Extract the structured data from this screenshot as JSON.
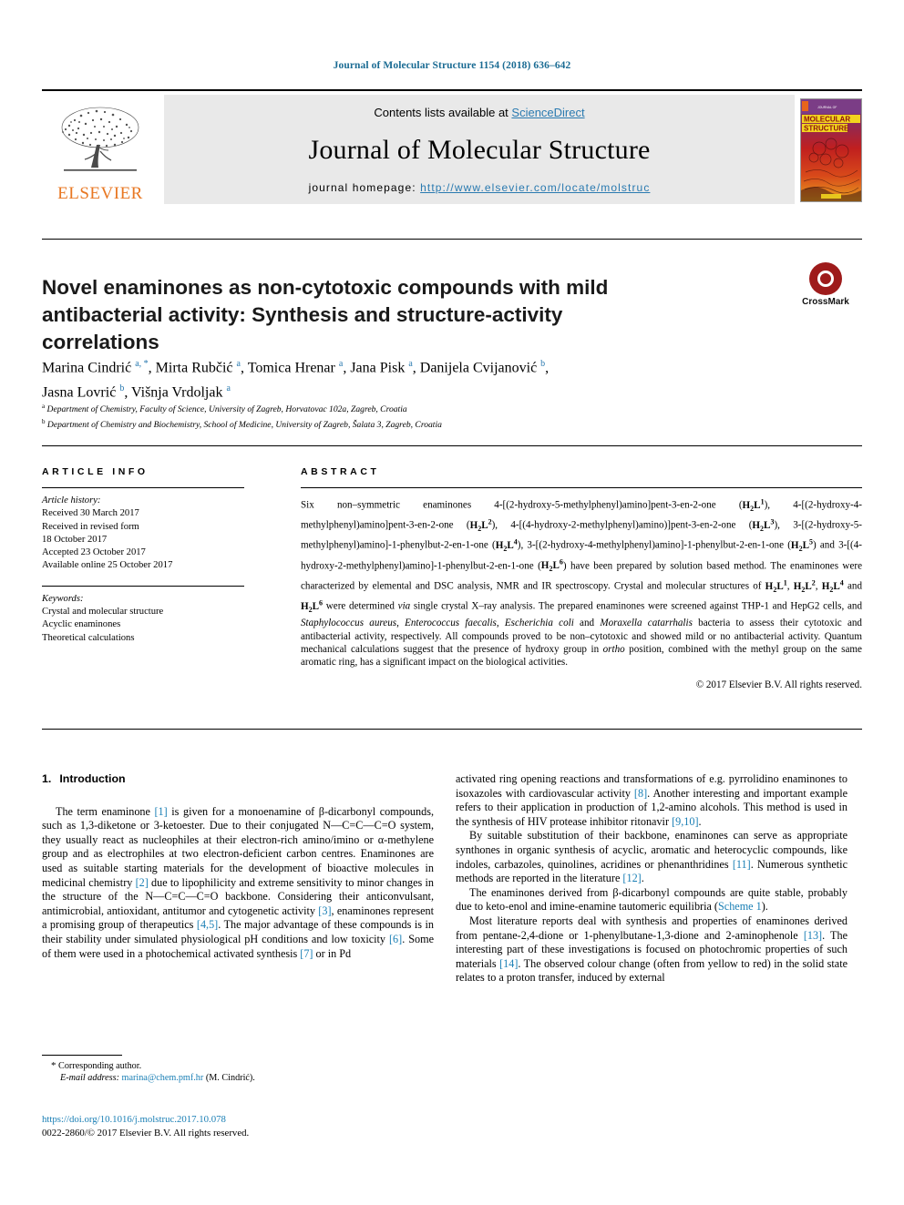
{
  "running_head": "Journal of Molecular Structure 1154 (2018) 636–642",
  "masthead": {
    "contents_prefix": "Contents lists available at ",
    "sciencedirect": "ScienceDirect",
    "journal_name": "Journal of Molecular Structure",
    "homepage_prefix": "journal homepage: ",
    "homepage_url": "http://www.elsevier.com/locate/molstruc",
    "publisher": "ELSEVIER",
    "cover_title_line1": "MOLECULAR",
    "cover_title_line2": "STRUCTURE",
    "colors": {
      "link": "#2a7ab0",
      "elsevier_orange": "#e87722",
      "panel_gray": "#e9e9e9"
    }
  },
  "crossmark": {
    "label": "CrossMark"
  },
  "article": {
    "title": "Novel enaminones as non-cytotoxic compounds with mild antibacterial activity: Synthesis and structure-activity correlations",
    "authors_line1": "Marina Cindrić a, *, Mirta Rubčić a, Tomica Hrenar a, Jana Pisk a, Danijela Cvijanović b,",
    "authors_line2": "Jasna Lovrić b, Višnja Vrdoljak a",
    "affiliation_a": "Department of Chemistry, Faculty of Science, University of Zagreb, Horvatovac 102a, Zagreb, Croatia",
    "affiliation_b": "Department of Chemistry and Biochemistry, School of Medicine, University of Zagreb, Šalata 3, Zagreb, Croatia"
  },
  "article_info": {
    "heading": "ARTICLE INFO",
    "history_label": "Article history:",
    "history": [
      "Received 30 March 2017",
      "Received in revised form",
      "18 October 2017",
      "Accepted 23 October 2017",
      "Available online 25 October 2017"
    ],
    "keywords_label": "Keywords:",
    "keywords": [
      "Crystal and molecular structure",
      "Acyclic enaminones",
      "Theoretical calculations"
    ]
  },
  "abstract": {
    "heading": "ABSTRACT",
    "copyright": "© 2017 Elsevier B.V. All rights reserved."
  },
  "introduction": {
    "number": "1.",
    "heading": "Introduction"
  },
  "footnote": {
    "corresponding": "Corresponding author.",
    "email_label": "E-mail address:",
    "email": "marina@chem.pmf.hr",
    "email_suffix": "(M. Cindrić)."
  },
  "bottom": {
    "doi": "https://doi.org/10.1016/j.molstruc.2017.10.078",
    "issn_line": "0022-2860/© 2017 Elsevier B.V. All rights reserved."
  }
}
